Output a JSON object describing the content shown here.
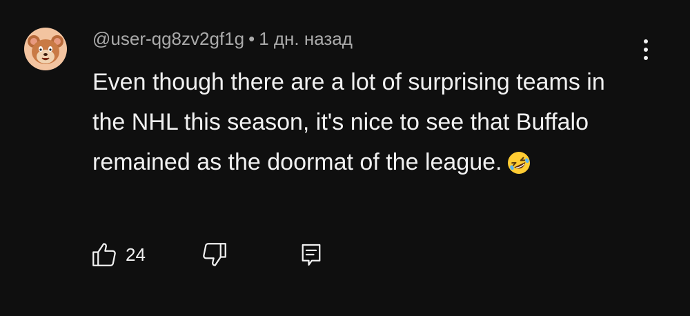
{
  "comment": {
    "author": "@user-qg8zv2gf1g",
    "separator": "•",
    "time": "1 дн. назад",
    "text": "Even though there are a lot of surprising teams in the NHL this season, it's nice to see that Buffalo remained as the doormat of the league.",
    "emoji": "rolling-on-floor-laughing",
    "likes": "24"
  },
  "icons": {
    "menu": "more-vert-icon",
    "like": "thumb-up-icon",
    "dislike": "thumb-down-icon",
    "reply": "reply-comment-icon"
  },
  "colors": {
    "background": "#0f0f0f",
    "text": "#f1f1f1",
    "meta": "#aaaaaa",
    "avatar_bg": "#f3c4a0"
  }
}
